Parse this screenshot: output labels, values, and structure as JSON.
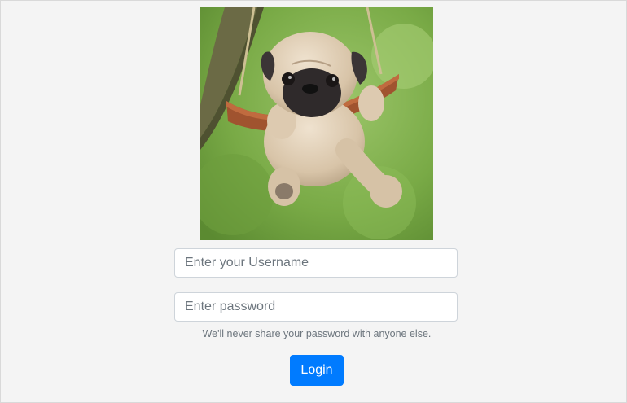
{
  "login_form": {
    "image_subject": "pug-puppy-on-swing",
    "username_placeholder": "Enter your Username",
    "password_placeholder": "Enter password",
    "help_text": "We'll never share your password with anyone else.",
    "login_label": "Login"
  },
  "colors": {
    "page_background": "#f4f4f4",
    "primary_button": "#007bff",
    "input_border": "#ced4da",
    "help_text": "#6c757d"
  }
}
